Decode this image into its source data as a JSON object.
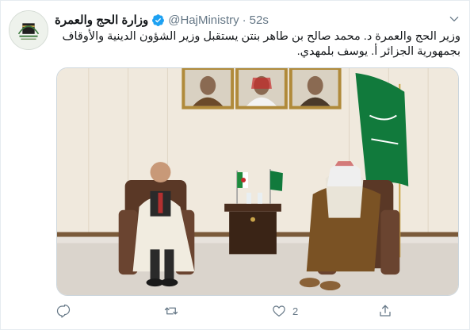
{
  "tweet": {
    "display_name": "وزارة الحج والعمرة",
    "handle": "@HajMinistry",
    "separator": "·",
    "timestamp": "52s",
    "text": "وزير الحج والعمرة د. محمد صالح بن طاهر بنتن يستقبل وزير الشؤون الدينية والأوقاف بجمهورية الجزائر أ. يوسف بلمهدي.",
    "avatar_icon": "hajj-ministry-logo",
    "verified_icon": "verified-badge-icon",
    "accent_color": "#1da1f2"
  },
  "actions": {
    "reply": {
      "icon": "reply-icon",
      "count": ""
    },
    "retweet": {
      "icon": "retweet-icon",
      "count": ""
    },
    "like": {
      "icon": "heart-icon",
      "count": "2"
    },
    "share": {
      "icon": "share-icon",
      "count": ""
    }
  }
}
